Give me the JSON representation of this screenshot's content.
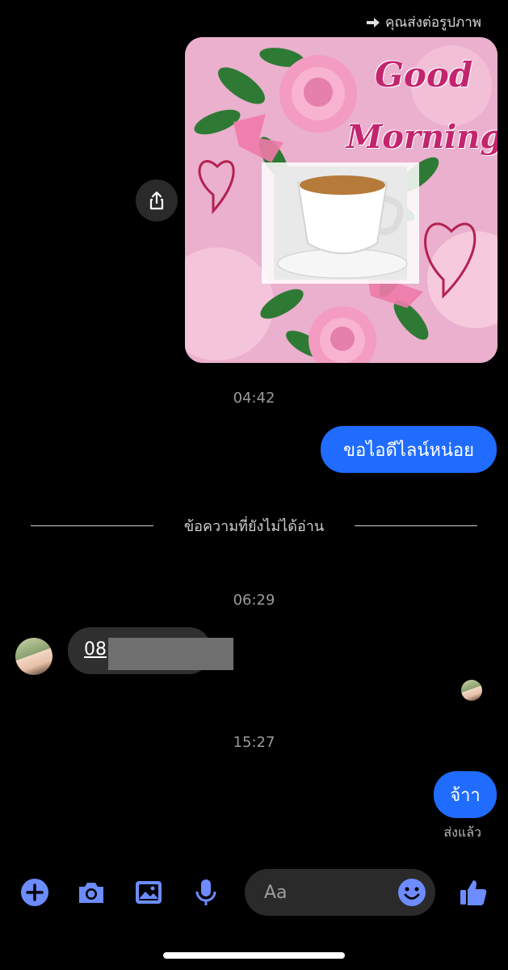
{
  "forward_note": "คุณส่งต่อรูปภาพ",
  "forwarded_image": {
    "line1": "Good",
    "line2": "Morning"
  },
  "messages": {
    "time_1": "04:42",
    "outgoing_1": "ขอไอดีไลน์หน่อย",
    "unread_divider": "ข้อความที่ยังไม่ได้อ่าน",
    "time_2": "06:29",
    "incoming_1_prefix": "08",
    "time_3": "15:27",
    "outgoing_2": "จ้าา",
    "status": "ส่งแล้ว"
  },
  "composer": {
    "placeholder": "Aa",
    "icons": [
      "plus-icon",
      "camera-icon",
      "gallery-icon",
      "microphone-icon",
      "emoji-icon",
      "thumbs-up-icon"
    ]
  },
  "colors": {
    "accent": "#1f6cff",
    "icon_blue": "#6c8cff",
    "incoming_bubble": "#2f2f2f"
  }
}
